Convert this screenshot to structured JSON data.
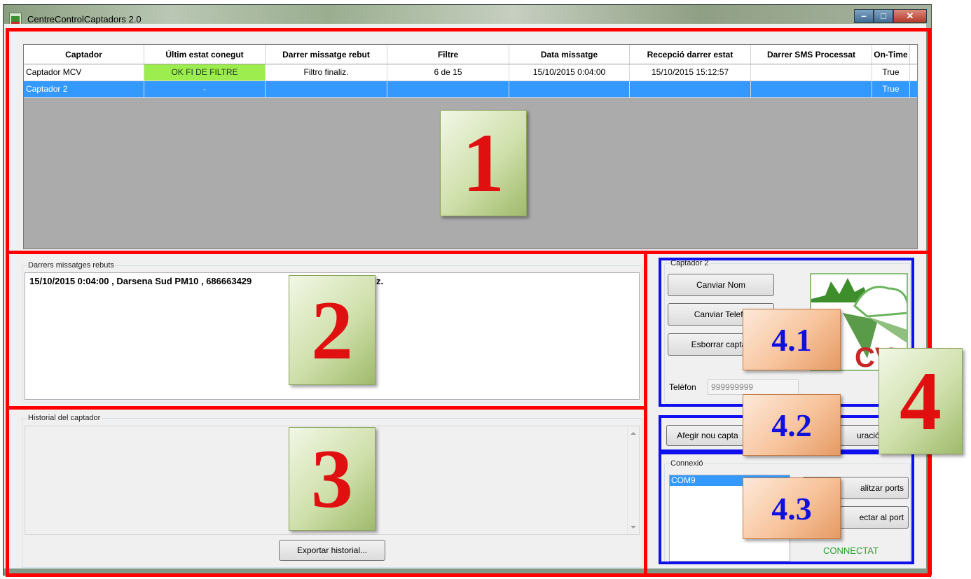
{
  "window": {
    "title": "CentreControlCaptadors 2.0"
  },
  "grid": {
    "columns": [
      "Captador",
      "Últim estat conegut",
      "Darrer missatge rebut",
      "Filtre",
      "Data missatge",
      "Recepció darrer estat",
      "Darrer SMS Processat",
      "On-Time"
    ],
    "rows": [
      [
        "Captador MCV",
        "OK FI DE FILTRE",
        "Filtro finaliz.",
        "6 de 15",
        "15/10/2015 0:04:00",
        "15/10/2015 15:12:57",
        "",
        "True"
      ],
      [
        "Captador 2",
        "-",
        "",
        "",
        "",
        "",
        "",
        "True"
      ]
    ],
    "highlight_color": "#9ded4e",
    "selected_color": "#3399ff"
  },
  "messages": {
    "label": "Darrers missatges rebuts",
    "line_visible_left": "15/10/2015 0:04:00 , Darsena Sud PM10 , 686663429",
    "line_visible_right": "iltro finaliz."
  },
  "history": {
    "label": "Historial del captador",
    "export_button": "Exportar historial..."
  },
  "captador": {
    "label": "Captador 2",
    "rename_button": "Canviar Nom",
    "phone_button": "Canviar Telefo",
    "delete_button": "Esborrar captac",
    "phone_label": "Telèfon",
    "phone_value": "999999999",
    "logo_text": "CV,s"
  },
  "actions": {
    "add_button": "Afegir nou capta",
    "config_button": "uració ale"
  },
  "connection": {
    "label": "Connexió",
    "ports": [
      "COM9"
    ],
    "refresh_button": "alitzar ports",
    "connect_button": "ectar al port",
    "status": "CONNECTAT",
    "status_color": "#2e9e2e"
  },
  "annotations": {
    "numbers": [
      "1",
      "2",
      "3",
      "4"
    ],
    "sub_numbers": [
      "4.1",
      "4.2",
      "4.3"
    ]
  }
}
